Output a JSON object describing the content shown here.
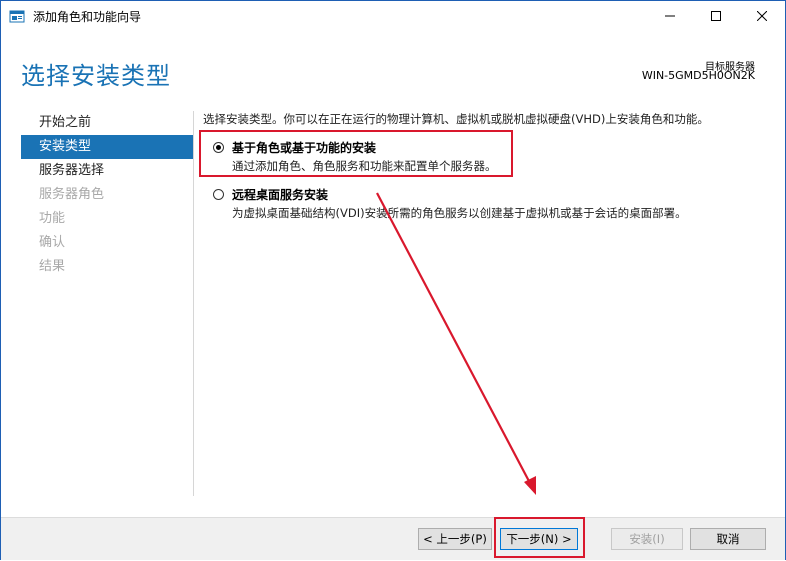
{
  "window": {
    "title": "添加角色和功能向导",
    "controls": {
      "minimize_icon": "minimize-icon",
      "maximize_icon": "maximize-icon",
      "close_icon": "close-icon"
    }
  },
  "header": {
    "page_title": "选择安装类型",
    "target_server_label": "目标服务器",
    "target_server_name": "WIN-5GMD5H0ON2K"
  },
  "nav": {
    "items": [
      {
        "label": "开始之前",
        "state": "normal"
      },
      {
        "label": "安装类型",
        "state": "active"
      },
      {
        "label": "服务器选择",
        "state": "normal"
      },
      {
        "label": "服务器角色",
        "state": "disabled"
      },
      {
        "label": "功能",
        "state": "disabled"
      },
      {
        "label": "确认",
        "state": "disabled"
      },
      {
        "label": "结果",
        "state": "disabled"
      }
    ]
  },
  "content": {
    "intro": "选择安装类型。你可以在正在运行的物理计算机、虚拟机或脱机虚拟硬盘(VHD)上安装角色和功能。",
    "options": [
      {
        "title": "基于角色或基于功能的安装",
        "desc": "通过添加角色、角色服务和功能来配置单个服务器。",
        "selected": true
      },
      {
        "title": "远程桌面服务安装",
        "desc": "为虚拟桌面基础结构(VDI)安装所需的角色服务以创建基于虚拟机或基于会话的桌面部署。",
        "selected": false
      }
    ]
  },
  "footer": {
    "prev": "< 上一步(P)",
    "next": "下一步(N) >",
    "install": "安装(I)",
    "cancel": "取消"
  },
  "colors": {
    "accent": "#1a73b5",
    "annotation": "#d9182d"
  }
}
